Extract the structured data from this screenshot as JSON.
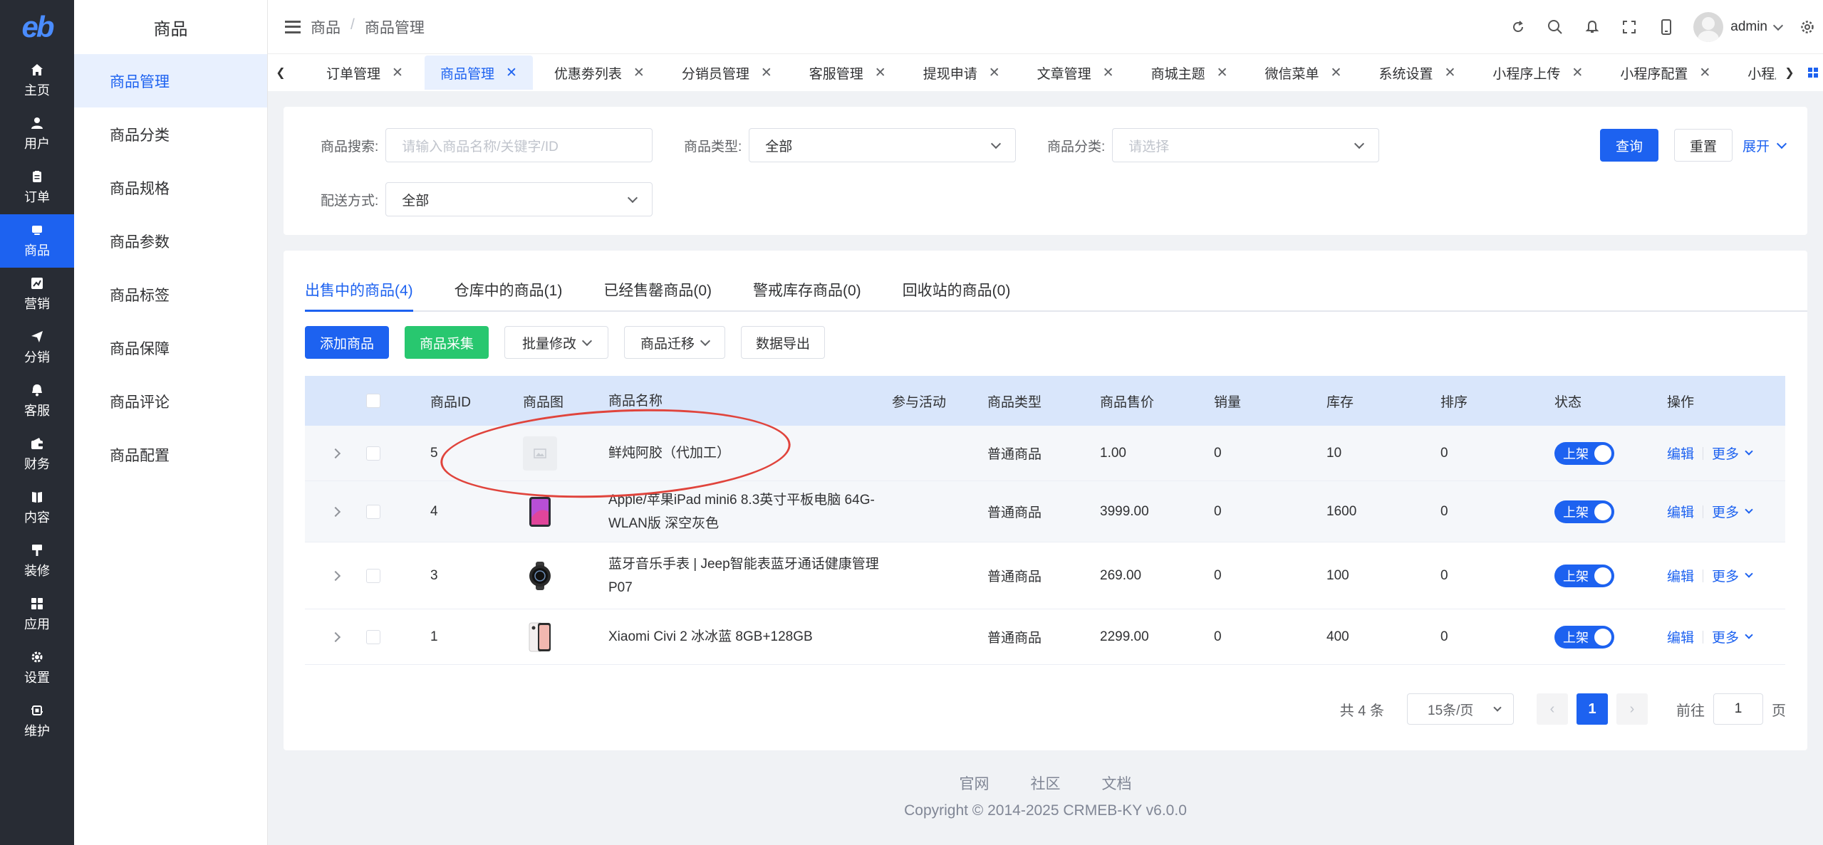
{
  "rail": {
    "logo": "eb",
    "items": [
      {
        "label": "主页",
        "icon": "home-icon"
      },
      {
        "label": "用户",
        "icon": "user-icon"
      },
      {
        "label": "订单",
        "icon": "order-icon"
      },
      {
        "label": "商品",
        "icon": "product-icon"
      },
      {
        "label": "营销",
        "icon": "marketing-icon"
      },
      {
        "label": "分销",
        "icon": "distribution-icon"
      },
      {
        "label": "客服",
        "icon": "service-icon"
      },
      {
        "label": "财务",
        "icon": "finance-icon"
      },
      {
        "label": "内容",
        "icon": "content-icon"
      },
      {
        "label": "装修",
        "icon": "decoration-icon"
      },
      {
        "label": "应用",
        "icon": "apps-icon"
      },
      {
        "label": "设置",
        "icon": "settings-icon"
      },
      {
        "label": "维护",
        "icon": "maintenance-icon"
      }
    ]
  },
  "subnav": {
    "title": "商品",
    "items": [
      "商品管理",
      "商品分类",
      "商品规格",
      "商品参数",
      "商品标签",
      "商品保障",
      "商品评论",
      "商品配置"
    ]
  },
  "header": {
    "breadcrumb": [
      "商品",
      "商品管理"
    ],
    "user": "admin"
  },
  "tabs": [
    "订单管理",
    "商品管理",
    "优惠劵列表",
    "分销员管理",
    "客服管理",
    "提现申请",
    "文章管理",
    "商城主题",
    "微信菜单",
    "系统设置",
    "小程序上传",
    "小程序配置",
    "小程序下载"
  ],
  "filters": {
    "search_label": "商品搜索:",
    "search_placeholder": "请输入商品名称/关键字/ID",
    "type_label": "商品类型:",
    "type_value": "全部",
    "category_label": "商品分类:",
    "category_placeholder": "请选择",
    "delivery_label": "配送方式:",
    "delivery_value": "全部",
    "query": "查询",
    "reset": "重置",
    "expand": "展开"
  },
  "list_tabs": [
    "出售中的商品(4)",
    "仓库中的商品(1)",
    "已经售罄商品(0)",
    "警戒库存商品(0)",
    "回收站的商品(0)"
  ],
  "actions": {
    "add": "添加商品",
    "collect": "商品采集",
    "batch": "批量修改",
    "migrate": "商品迁移",
    "export": "数据导出"
  },
  "table": {
    "headers": [
      "商品ID",
      "商品图",
      "商品名称",
      "参与活动",
      "商品类型",
      "商品售价",
      "销量",
      "库存",
      "排序",
      "状态",
      "操作"
    ],
    "rows": [
      {
        "id": "5",
        "name": "鲜炖阿胶（代加工）",
        "activity": "",
        "type": "普通商品",
        "price": "1.00",
        "sales": "0",
        "stock": "10",
        "sort": "0",
        "status": "上架"
      },
      {
        "id": "4",
        "name": "Apple/苹果iPad mini6 8.3英寸平板电脑 64G-WLAN版 深空灰色",
        "activity": "",
        "type": "普通商品",
        "price": "3999.00",
        "sales": "0",
        "stock": "1600",
        "sort": "0",
        "status": "上架"
      },
      {
        "id": "3",
        "name": "蓝牙音乐手表 | Jeep智能表蓝牙通话健康管理P07",
        "activity": "",
        "type": "普通商品",
        "price": "269.00",
        "sales": "0",
        "stock": "100",
        "sort": "0",
        "status": "上架"
      },
      {
        "id": "1",
        "name": "Xiaomi Civi 2 冰冰蓝 8GB+128GB",
        "activity": "",
        "type": "普通商品",
        "price": "2299.00",
        "sales": "0",
        "stock": "400",
        "sort": "0",
        "status": "上架"
      }
    ],
    "edit": "编辑",
    "more": "更多"
  },
  "pagination": {
    "total": "共 4 条",
    "page_size": "15条/页",
    "current": "1",
    "goto_label": "前往",
    "goto_value": "1",
    "page_suffix": "页"
  },
  "footer": {
    "links": [
      "官网",
      "社区",
      "文档"
    ],
    "copyright": "Copyright © 2014-2025 CRMEB-KY v6.0.0"
  },
  "colors": {
    "rail_bg": "#282c34",
    "primary": "#1d62f0",
    "success": "#28c76f",
    "annotation": "#e0443c"
  }
}
